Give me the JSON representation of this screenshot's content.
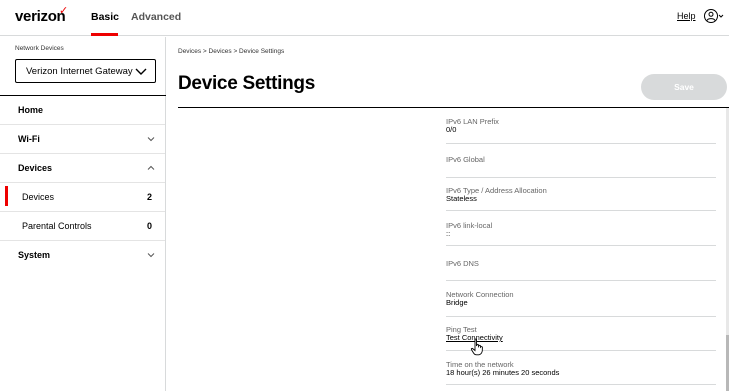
{
  "header": {
    "logo": "verizon",
    "logo_check": "✓",
    "nav_basic": "Basic",
    "nav_advanced": "Advanced",
    "help": "Help"
  },
  "sidebar": {
    "network_devices_label": "Network Devices",
    "network_devices_selected": "Verizon Internet Gateway",
    "items": [
      {
        "label": "Home"
      },
      {
        "label": "Wi-Fi"
      },
      {
        "label": "Devices"
      },
      {
        "label": "Devices",
        "count": "2"
      },
      {
        "label": "Parental Controls",
        "count": "0"
      },
      {
        "label": "System"
      }
    ]
  },
  "main": {
    "breadcrumb": "Devices  >  Devices  >  Device Settings",
    "title": "Device Settings",
    "save": "Save",
    "details": [
      {
        "key": "IPv6 LAN Prefix",
        "value": "0/0"
      },
      {
        "key": "IPv6 Global",
        "value": ""
      },
      {
        "key": "IPv6 Type / Address Allocation",
        "value": "Stateless"
      },
      {
        "key": "IPv6 link-local",
        "value": "::"
      },
      {
        "key": "IPv6 DNS",
        "value": ""
      },
      {
        "key": "Network Connection",
        "value": "Bridge"
      },
      {
        "key": "Ping Test",
        "value": "Test Connectivity"
      },
      {
        "key": "Time on the network",
        "value": "18 hour(s) 26 minutes 20 seconds"
      }
    ]
  },
  "colors": {
    "accent_red": "#ee0000",
    "save_disabled": "#d8dadb"
  }
}
